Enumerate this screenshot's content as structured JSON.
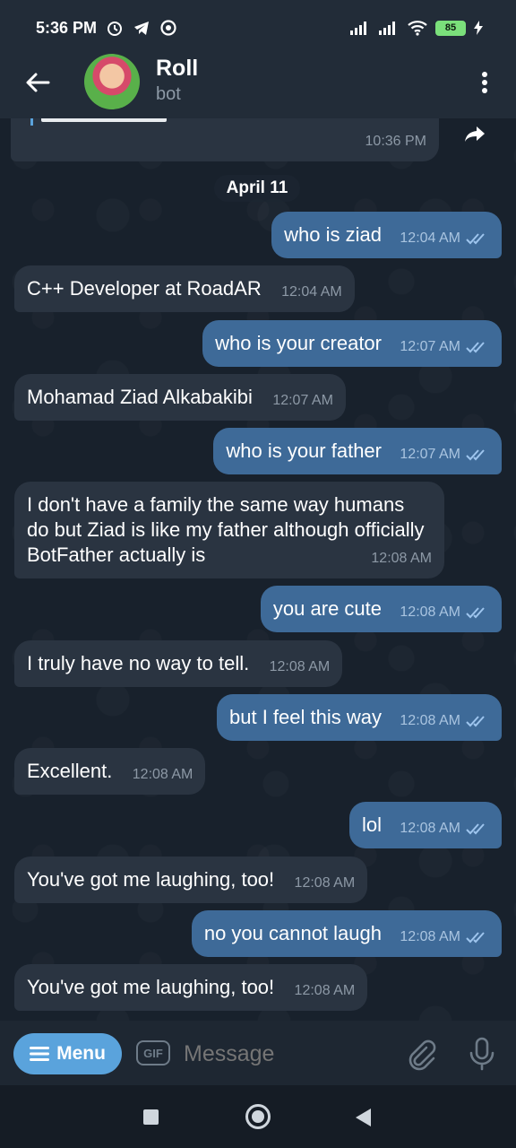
{
  "status_bar": {
    "time": "5:36 PM",
    "battery": "85",
    "icons": [
      "alarm-icon",
      "telegram-icon",
      "vpn-icon",
      "signal-icon",
      "signal-icon",
      "wifi-icon",
      "battery-icon",
      "charging-icon"
    ]
  },
  "header": {
    "title": "Roll",
    "subtitle": "bot"
  },
  "chat": {
    "previous_message_time": "10:36 PM",
    "date_label": "April 11",
    "messages": [
      {
        "dir": "out",
        "text": "who is ziad",
        "time": "12:04 AM"
      },
      {
        "dir": "in",
        "text": "C++ Developer at RoadAR",
        "time": "12:04 AM"
      },
      {
        "dir": "out",
        "text": "who is your creator",
        "time": "12:07 AM"
      },
      {
        "dir": "in",
        "text": "Mohamad Ziad Alkabakibi",
        "time": "12:07 AM"
      },
      {
        "dir": "out",
        "text": "who is your father",
        "time": "12:07 AM"
      },
      {
        "dir": "in",
        "text": "I don't have a family the same way humans do but Ziad is like my father although officially BotFather actually is",
        "time": "12:08 AM"
      },
      {
        "dir": "out",
        "text": "you are cute",
        "time": "12:08 AM"
      },
      {
        "dir": "in",
        "text": "I truly have no way to tell.",
        "time": "12:08 AM"
      },
      {
        "dir": "out",
        "text": "but I feel this way",
        "time": "12:08 AM"
      },
      {
        "dir": "in",
        "text": "Excellent.",
        "time": "12:08 AM"
      },
      {
        "dir": "out",
        "text": "lol",
        "time": "12:08 AM"
      },
      {
        "dir": "in",
        "text": "You've got me laughing, too!",
        "time": "12:08 AM"
      },
      {
        "dir": "out",
        "text": "no you cannot laugh",
        "time": "12:08 AM"
      },
      {
        "dir": "in",
        "text": "You've got me laughing, too!",
        "time": "12:08 AM"
      }
    ]
  },
  "input_bar": {
    "menu_label": "Menu",
    "gif_label": "GIF",
    "placeholder": "Message"
  },
  "colors": {
    "incoming_bubble": "#2a3441",
    "outgoing_bubble": "#3e6a98",
    "menu_button": "#5aa3dc",
    "background": "#18212c"
  }
}
